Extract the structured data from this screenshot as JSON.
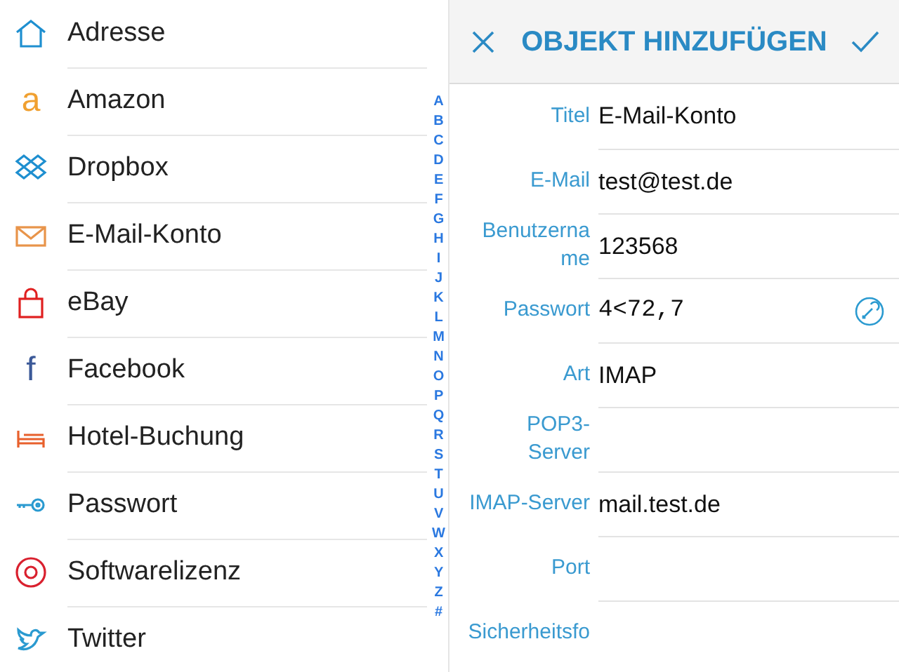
{
  "list": {
    "items": [
      {
        "label": "Adresse",
        "color": "#1e8fd0"
      },
      {
        "label": "Amazon",
        "glyph": "a",
        "color": "#f0a030"
      },
      {
        "label": "Dropbox",
        "color": "#1e8fd0"
      },
      {
        "label": "E-Mail-Konto",
        "color": "#e8944a"
      },
      {
        "label": "eBay",
        "color": "#e02020"
      },
      {
        "label": "Facebook",
        "glyph": "f",
        "color": "#3b5998"
      },
      {
        "label": "Hotel-Buchung",
        "color": "#e8602c"
      },
      {
        "label": "Passwort",
        "color": "#2a9ad0"
      },
      {
        "label": "Softwarelizenz",
        "color": "#d9202e"
      },
      {
        "label": "Twitter",
        "color": "#2a9ad0"
      }
    ],
    "index": [
      "A",
      "B",
      "C",
      "D",
      "E",
      "F",
      "G",
      "H",
      "I",
      "J",
      "K",
      "L",
      "M",
      "N",
      "O",
      "P",
      "Q",
      "R",
      "S",
      "T",
      "U",
      "V",
      "W",
      "X",
      "Y",
      "Z",
      "#"
    ]
  },
  "dialog": {
    "title": "OBJEKT HINZUFÜGEN",
    "fields": [
      {
        "label": "Titel",
        "value": "E-Mail-Konto",
        "kind": "text"
      },
      {
        "label": "E-Mail",
        "value": "test@test.de",
        "kind": "text"
      },
      {
        "label": "Benutzername",
        "value": "123568",
        "kind": "text"
      },
      {
        "label": "Passwort",
        "value": "4<72,7",
        "kind": "password"
      },
      {
        "label": "Art",
        "value": "IMAP",
        "kind": "text"
      },
      {
        "label": "POP3-Server",
        "kind": "text"
      },
      {
        "label": "IMAP-Server",
        "value": "mail.test.de",
        "kind": "text"
      },
      {
        "label": "Port",
        "kind": "text"
      },
      {
        "label": "Sicherheitsfo",
        "kind": "text"
      }
    ]
  }
}
